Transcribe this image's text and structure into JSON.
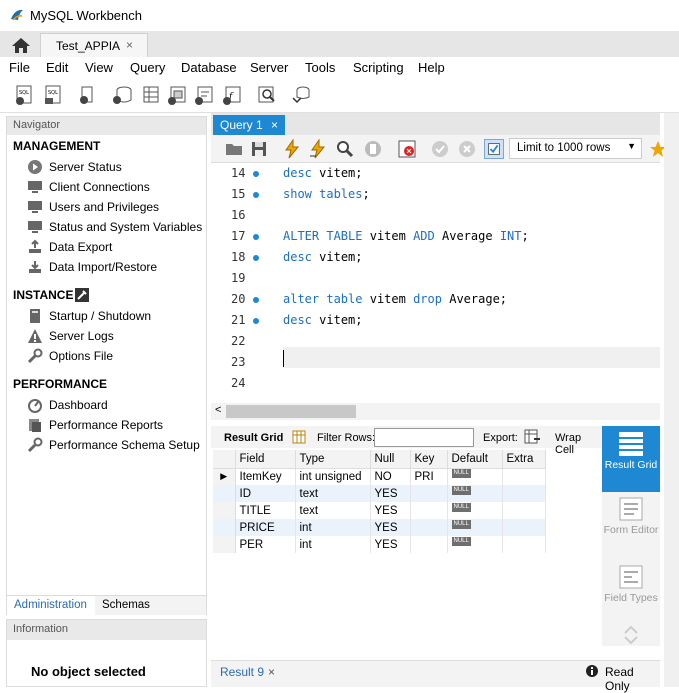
{
  "window": {
    "title": "MySQL Workbench"
  },
  "connection_tab": {
    "label": "Test_APPIA",
    "close": "×"
  },
  "menubar": {
    "items": [
      "File",
      "Edit",
      "View",
      "Query",
      "Database",
      "Server",
      "Tools",
      "Scripting",
      "Help"
    ]
  },
  "navigator": {
    "header": "Navigator",
    "management": {
      "title": "MANAGEMENT",
      "items": [
        "Server Status",
        "Client Connections",
        "Users and Privileges",
        "Status and System Variables",
        "Data Export",
        "Data Import/Restore"
      ]
    },
    "instance": {
      "title": "INSTANCE",
      "items": [
        "Startup / Shutdown",
        "Server Logs",
        "Options File"
      ]
    },
    "performance": {
      "title": "PERFORMANCE",
      "items": [
        "Dashboard",
        "Performance Reports",
        "Performance Schema Setup"
      ]
    },
    "tabs": [
      "Administration",
      "Schemas"
    ]
  },
  "information": {
    "header": "Information",
    "body": "No object selected"
  },
  "query_tab": {
    "label": "Query 1",
    "close": "×"
  },
  "query_toolbar": {
    "limit": "Limit to 1000 rows"
  },
  "editor": {
    "lines": [
      {
        "num": "14",
        "dot": true,
        "code": [
          [
            "kw",
            "desc"
          ],
          [
            "",
            "vitem;"
          ]
        ]
      },
      {
        "num": "15",
        "dot": true,
        "code": [
          [
            "kw",
            "show tables"
          ],
          [
            "",
            ";"
          ]
        ]
      },
      {
        "num": "16",
        "dot": false,
        "code": []
      },
      {
        "num": "17",
        "dot": true,
        "code": [
          [
            "kw",
            "ALTER TABLE"
          ],
          [
            "",
            "vitem"
          ],
          [
            "kw",
            "ADD"
          ],
          [
            "",
            "Average"
          ],
          [
            "kw",
            "INT"
          ],
          [
            "",
            ";"
          ]
        ]
      },
      {
        "num": "18",
        "dot": true,
        "code": [
          [
            "kw",
            "desc"
          ],
          [
            "",
            "vitem;"
          ]
        ]
      },
      {
        "num": "19",
        "dot": false,
        "code": []
      },
      {
        "num": "20",
        "dot": true,
        "code": [
          [
            "kw",
            "alter table"
          ],
          [
            "",
            "vitem"
          ],
          [
            "kw",
            "drop"
          ],
          [
            "",
            "Average;"
          ]
        ]
      },
      {
        "num": "21",
        "dot": true,
        "code": [
          [
            "kw",
            "desc"
          ],
          [
            "",
            "vitem;"
          ]
        ]
      },
      {
        "num": "22",
        "dot": false,
        "code": []
      },
      {
        "num": "23",
        "dot": false,
        "code": []
      },
      {
        "num": "24",
        "dot": false,
        "code": []
      }
    ]
  },
  "result_toolbar": {
    "result_grid": "Result Grid",
    "filter_label": "Filter Rows:",
    "export_label": "Export:",
    "wrap_label": "Wrap Cell"
  },
  "result_grid": {
    "columns": [
      "Field",
      "Type",
      "Null",
      "Key",
      "Default",
      "Extra"
    ],
    "rows": [
      [
        "ItemKey",
        "int unsigned",
        "NO",
        "PRI",
        "NULL",
        ""
      ],
      [
        "ID",
        "text",
        "YES",
        "",
        "NULL",
        ""
      ],
      [
        "TITLE",
        "text",
        "YES",
        "",
        "NULL",
        ""
      ],
      [
        "PRICE",
        "int",
        "YES",
        "",
        "NULL",
        ""
      ],
      [
        "PER",
        "int",
        "YES",
        "",
        "NULL",
        ""
      ]
    ]
  },
  "side_panel": {
    "result_grid": "Result Grid",
    "form_editor": "Form Editor",
    "field_types": "Field Types"
  },
  "bottom": {
    "result_tab": "Result 9",
    "close": "×",
    "status": "Read Only"
  },
  "colors": {
    "accent": "#1e88d2",
    "keyword": "#1c6fc2"
  }
}
